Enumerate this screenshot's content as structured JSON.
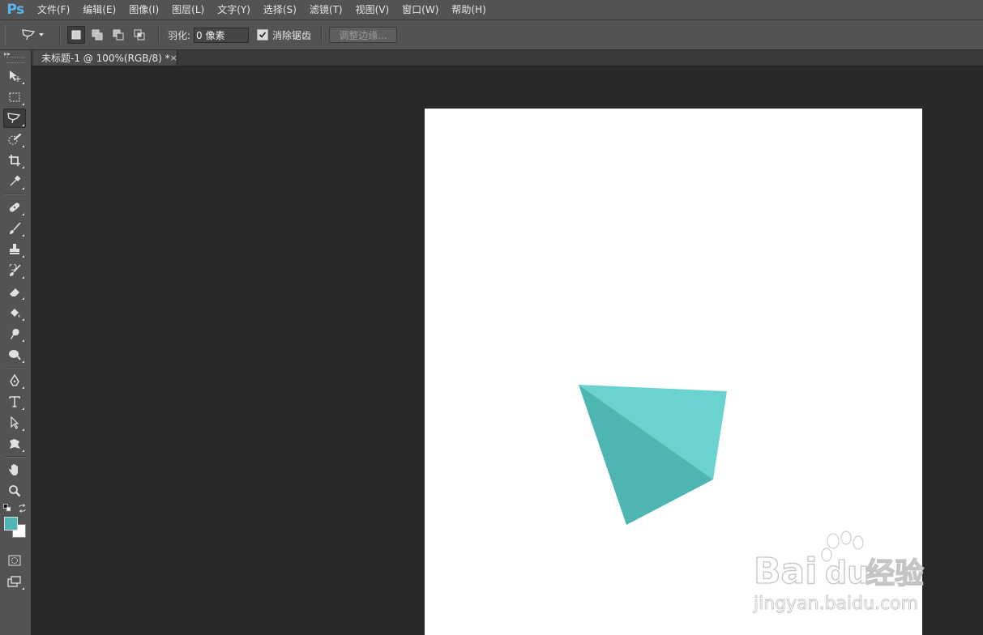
{
  "app": {
    "logo": "Ps"
  },
  "menu": [
    "文件(F)",
    "编辑(E)",
    "图像(I)",
    "图层(L)",
    "文字(Y)",
    "选择(S)",
    "滤镜(T)",
    "视图(V)",
    "窗口(W)",
    "帮助(H)"
  ],
  "options": {
    "feather_label": "羽化:",
    "feather_value": "0 像素",
    "antialias_label": "消除锯齿",
    "antialias_checked": true,
    "refine_edge_label": "调整边缘..."
  },
  "document": {
    "tab_title": "未标题-1 @ 100%(RGB/8) *",
    "close_glyph": "×"
  },
  "colors": {
    "foreground": "#4db6b2",
    "background": "#ffffff",
    "shape_light": "#6ad3cf",
    "shape_dark": "#4db6b2"
  },
  "tools": [
    "move-tool-icon",
    "marquee-tool-icon",
    "polygonal-lasso-tool-icon",
    "quick-selection-tool-icon",
    "crop-tool-icon",
    "eyedropper-tool-icon",
    "healing-brush-tool-icon",
    "brush-tool-icon",
    "clone-stamp-tool-icon",
    "history-brush-tool-icon",
    "eraser-tool-icon",
    "paint-bucket-tool-icon",
    "blur-tool-icon",
    "dodge-tool-icon",
    "pen-tool-icon",
    "type-tool-icon",
    "path-selection-tool-icon",
    "custom-shape-tool-icon",
    "hand-tool-icon",
    "zoom-tool-icon",
    "quick-mask-icon",
    "screen-mode-icon"
  ],
  "watermark": {
    "brand": "Bai",
    "brand_suffix": "du",
    "service": "经验",
    "url": "jingyan.baidu.com"
  }
}
